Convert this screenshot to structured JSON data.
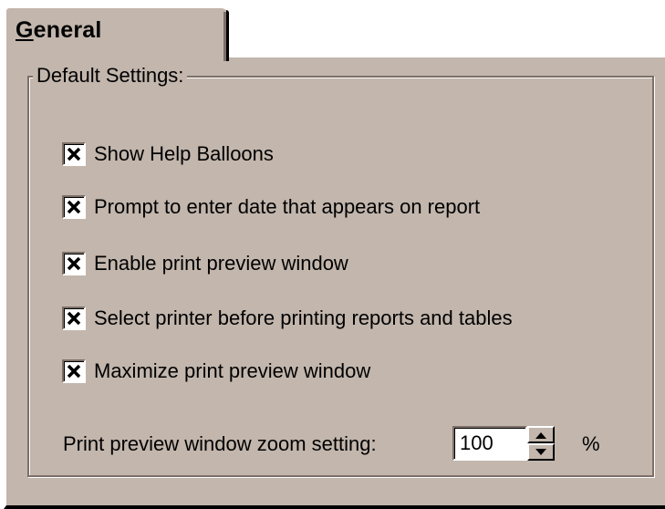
{
  "tab": {
    "label_prefix": "G",
    "label_rest": "eneral"
  },
  "group": {
    "title": "Default Settings:"
  },
  "checkboxes": [
    {
      "label": "Show Help Balloons",
      "checked": true
    },
    {
      "label": "Prompt to enter date that appears on report",
      "checked": true
    },
    {
      "label": "Enable print preview window",
      "checked": true
    },
    {
      "label": "Select printer before printing reports and tables",
      "checked": true
    },
    {
      "label": "Maximize print preview window",
      "checked": true
    }
  ],
  "zoom": {
    "label": "Print preview window zoom setting:",
    "value": "100",
    "unit": "%"
  },
  "colors": {
    "face": "#c2b6ad",
    "shadow": "#7d7068",
    "highlight": "#ffffff"
  }
}
